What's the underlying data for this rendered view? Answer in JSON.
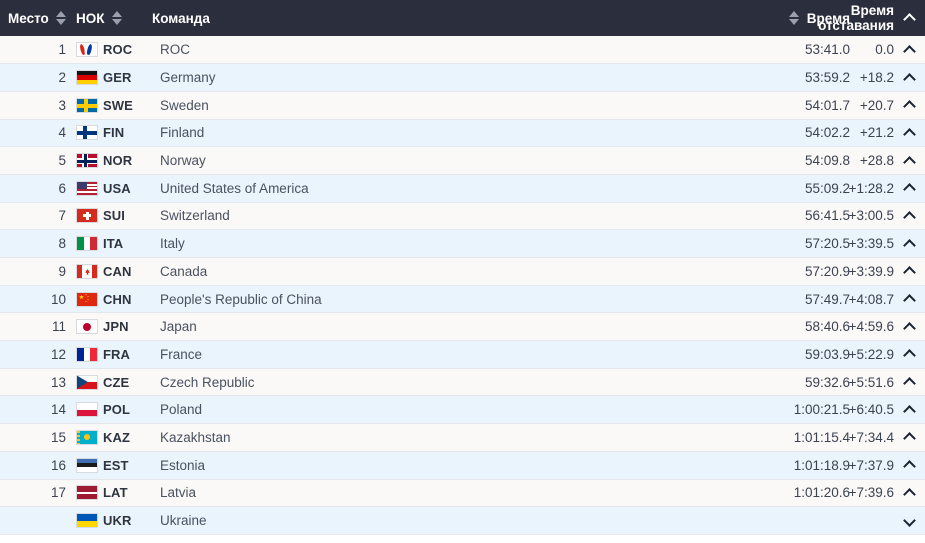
{
  "table": {
    "columns": {
      "rank": "Место",
      "noc": "НОК",
      "team": "Команда",
      "time": "Время",
      "gap_line1": "Время",
      "gap_line2": "отставания"
    },
    "icons": {
      "sort": "sort-updown-icon",
      "header_chevron": "chevron-up-icon",
      "row_expand": "chevron-up-icon",
      "row_collapse": "chevron-down-icon"
    },
    "rows": [
      {
        "rank": "1",
        "noc": "ROC",
        "flag": "roc",
        "team": "ROC",
        "time": "53:41.0",
        "gap": "0.0",
        "chevron": "up"
      },
      {
        "rank": "2",
        "noc": "GER",
        "flag": "ger",
        "team": "Germany",
        "time": "53:59.2",
        "gap": "+18.2",
        "chevron": "up"
      },
      {
        "rank": "3",
        "noc": "SWE",
        "flag": "swe",
        "team": "Sweden",
        "time": "54:01.7",
        "gap": "+20.7",
        "chevron": "up"
      },
      {
        "rank": "4",
        "noc": "FIN",
        "flag": "fin",
        "team": "Finland",
        "time": "54:02.2",
        "gap": "+21.2",
        "chevron": "up"
      },
      {
        "rank": "5",
        "noc": "NOR",
        "flag": "nor",
        "team": "Norway",
        "time": "54:09.8",
        "gap": "+28.8",
        "chevron": "up"
      },
      {
        "rank": "6",
        "noc": "USA",
        "flag": "usa",
        "team": "United States of America",
        "time": "55:09.2",
        "gap": "+1:28.2",
        "chevron": "up"
      },
      {
        "rank": "7",
        "noc": "SUI",
        "flag": "sui",
        "team": "Switzerland",
        "time": "56:41.5",
        "gap": "+3:00.5",
        "chevron": "up"
      },
      {
        "rank": "8",
        "noc": "ITA",
        "flag": "ita",
        "team": "Italy",
        "time": "57:20.5",
        "gap": "+3:39.5",
        "chevron": "up"
      },
      {
        "rank": "9",
        "noc": "CAN",
        "flag": "can",
        "team": "Canada",
        "time": "57:20.9",
        "gap": "+3:39.9",
        "chevron": "up"
      },
      {
        "rank": "10",
        "noc": "CHN",
        "flag": "chn",
        "team": "People's Republic of China",
        "time": "57:49.7",
        "gap": "+4:08.7",
        "chevron": "up"
      },
      {
        "rank": "11",
        "noc": "JPN",
        "flag": "jpn",
        "team": "Japan",
        "time": "58:40.6",
        "gap": "+4:59.6",
        "chevron": "up"
      },
      {
        "rank": "12",
        "noc": "FRA",
        "flag": "fra",
        "team": "France",
        "time": "59:03.9",
        "gap": "+5:22.9",
        "chevron": "up"
      },
      {
        "rank": "13",
        "noc": "CZE",
        "flag": "cze",
        "team": "Czech Republic",
        "time": "59:32.6",
        "gap": "+5:51.6",
        "chevron": "up"
      },
      {
        "rank": "14",
        "noc": "POL",
        "flag": "pol",
        "team": "Poland",
        "time": "1:00:21.5",
        "gap": "+6:40.5",
        "chevron": "up"
      },
      {
        "rank": "15",
        "noc": "KAZ",
        "flag": "kaz",
        "team": "Kazakhstan",
        "time": "1:01:15.4",
        "gap": "+7:34.4",
        "chevron": "up"
      },
      {
        "rank": "16",
        "noc": "EST",
        "flag": "est",
        "team": "Estonia",
        "time": "1:01:18.9",
        "gap": "+7:37.9",
        "chevron": "up"
      },
      {
        "rank": "17",
        "noc": "LAT",
        "flag": "lat",
        "team": "Latvia",
        "time": "1:01:20.6",
        "gap": "+7:39.6",
        "chevron": "up"
      },
      {
        "rank": "",
        "noc": "UKR",
        "flag": "ukr",
        "team": "Ukraine",
        "time": "",
        "gap": "",
        "chevron": "down"
      }
    ]
  },
  "colors": {
    "header_bg": "#2b2f3d",
    "row_odd_bg": "#faf9f7",
    "row_even_bg": "#e9f4fd",
    "row_border": "#e3e6ea",
    "text": "#3c4250",
    "header_text": "#ffffff",
    "sort_icon": "#9aa0ae"
  }
}
